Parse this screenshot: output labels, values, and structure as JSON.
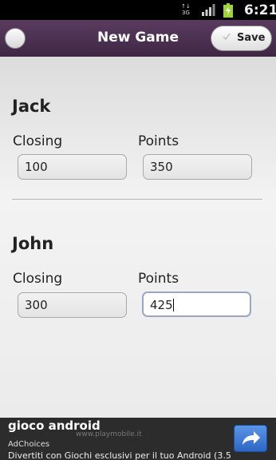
{
  "status_bar": {
    "network": "3G",
    "time": "6:21"
  },
  "header": {
    "title": "New Game",
    "save_label": "Save"
  },
  "players": [
    {
      "name": "Jack",
      "closing_label": "Closing",
      "closing_value": "100",
      "points_label": "Points",
      "points_value": "350"
    },
    {
      "name": "John",
      "closing_label": "Closing",
      "closing_value": "300",
      "points_label": "Points",
      "points_value": "425"
    }
  ],
  "ad": {
    "title": "gioco android",
    "url": "www.playmobile.it",
    "choices": "AdChoices",
    "description": "Divertiti con Giochi esclusivi per il tuo Android (3.5"
  }
}
